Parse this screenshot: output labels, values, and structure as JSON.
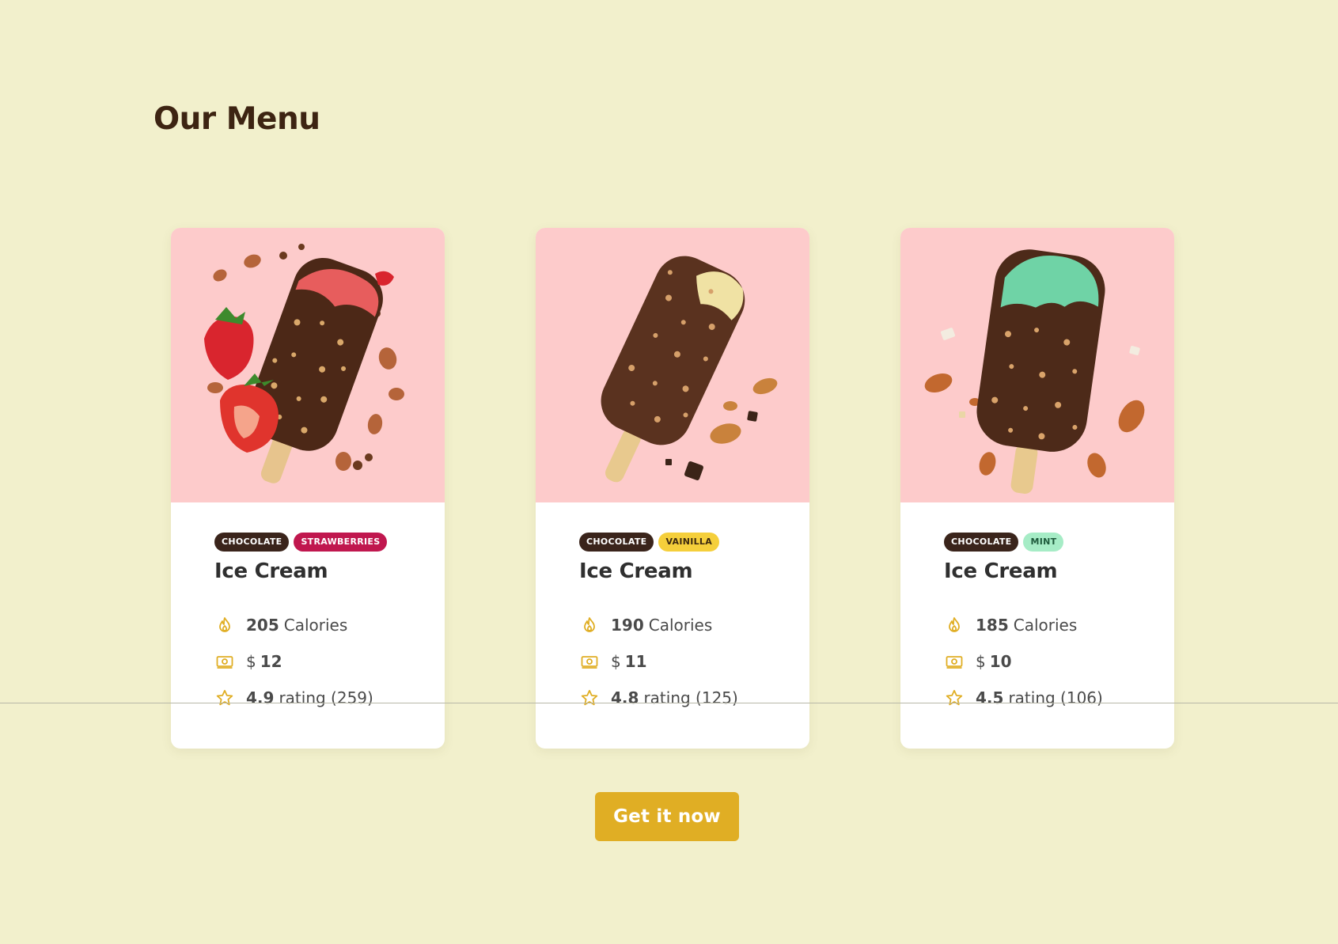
{
  "page": {
    "title": "Our Menu"
  },
  "colors": {
    "background": "#f2f0cc",
    "image_bg": "#fdcbcb",
    "accent": "#e0ae24",
    "chocolate_tag": "#3a241b",
    "strawberries_tag": "#c0174e",
    "vainilla_tag": "#f5cf3b",
    "mint_tag": "#a6ecc6"
  },
  "cards": [
    {
      "tags": [
        "CHOCOLATE",
        "STRAWBERRIES"
      ],
      "name": "Ice Cream",
      "calories_value": "205",
      "calories_label": "Calories",
      "currency": "$",
      "price": "12",
      "rating_value": "4.9",
      "rating_label": "rating (259)",
      "image": "chocolate-strawberry-ice-cream-bar"
    },
    {
      "tags": [
        "CHOCOLATE",
        "VAINILLA"
      ],
      "name": "Ice Cream",
      "calories_value": "190",
      "calories_label": "Calories",
      "currency": "$",
      "price": "11",
      "rating_value": "4.8",
      "rating_label": "rating (125)",
      "image": "chocolate-vanilla-ice-cream-bar"
    },
    {
      "tags": [
        "CHOCOLATE",
        "MINT"
      ],
      "name": "Ice Cream",
      "calories_value": "185",
      "calories_label": "Calories",
      "currency": "$",
      "price": "10",
      "rating_value": "4.5",
      "rating_label": "rating (106)",
      "image": "chocolate-mint-ice-cream-bar"
    }
  ],
  "icons": {
    "calories": "flame-icon",
    "price": "cash-icon",
    "rating": "star-icon"
  },
  "cta": {
    "label": "Get it now"
  }
}
